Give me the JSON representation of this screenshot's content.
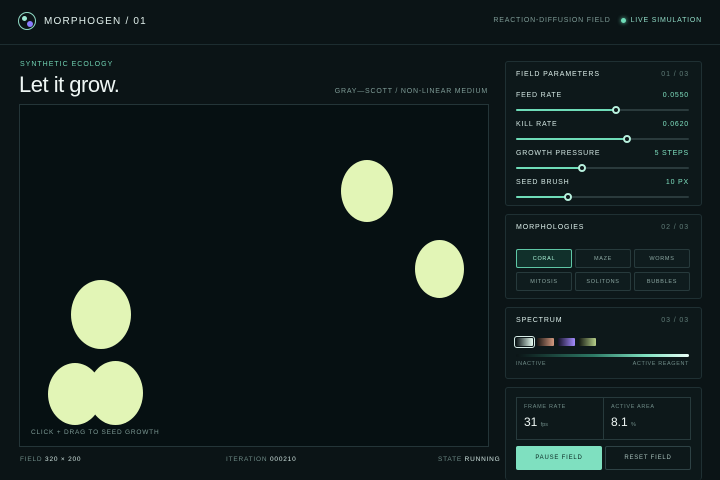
{
  "header": {
    "brand": "MORPHOGEN / 01",
    "mode": "REACTION-DIFFUSION FIELD",
    "live": "LIVE SIMULATION"
  },
  "hero": {
    "eyebrow": "SYNTHETIC ECOLOGY",
    "title": "Let it grow.",
    "subtitle": "GRAY—SCOTT / NON-LINEAR MEDIUM"
  },
  "canvas": {
    "hint": "CLICK + DRAG TO SEED GROWTH",
    "blob_color": "#e2f5b6",
    "background": "#061012"
  },
  "footer": {
    "field_label": "FIELD",
    "field_value": "320 × 200",
    "iteration_label": "ITERATION",
    "iteration_value": "000210",
    "state_label": "STATE",
    "state_value": "RUNNING"
  },
  "params": {
    "title": "FIELD PARAMETERS",
    "index": "01 / 03",
    "items": [
      {
        "label": "FEED RATE",
        "value": "0.0550",
        "level": 0.58
      },
      {
        "label": "KILL RATE",
        "value": "0.0620",
        "level": 0.64
      },
      {
        "label": "GROWTH PRESSURE",
        "value": "5 STEPS",
        "level": 0.38
      },
      {
        "label": "SEED BRUSH",
        "value": "10 PX",
        "level": 0.3
      }
    ]
  },
  "morphologies": {
    "title": "MORPHOLOGIES",
    "index": "02 / 03",
    "options": [
      "CORAL",
      "MAZE",
      "WORMS",
      "MITOSIS",
      "SOLITONS",
      "BUBBLES"
    ],
    "selected": "CORAL"
  },
  "spectrum": {
    "title": "SPECTRUM",
    "index": "03 / 03",
    "left_label": "INACTIVE",
    "right_label": "ACTIVE REAGENT",
    "swatches": [
      "swatch-mint",
      "swatch-copper",
      "swatch-violet",
      "swatch-olive"
    ]
  },
  "stats": {
    "frame_rate_label": "FRAME RATE",
    "frame_rate_value": "31",
    "frame_rate_unit": "fps",
    "active_area_label": "ACTIVE AREA",
    "active_area_value": "8.1",
    "active_area_unit": "%"
  },
  "actions": {
    "pause": "PAUSE FIELD",
    "reset": "RESET FIELD"
  },
  "colors": {
    "accent": "#7fe0c0",
    "background": "#0b1416"
  }
}
